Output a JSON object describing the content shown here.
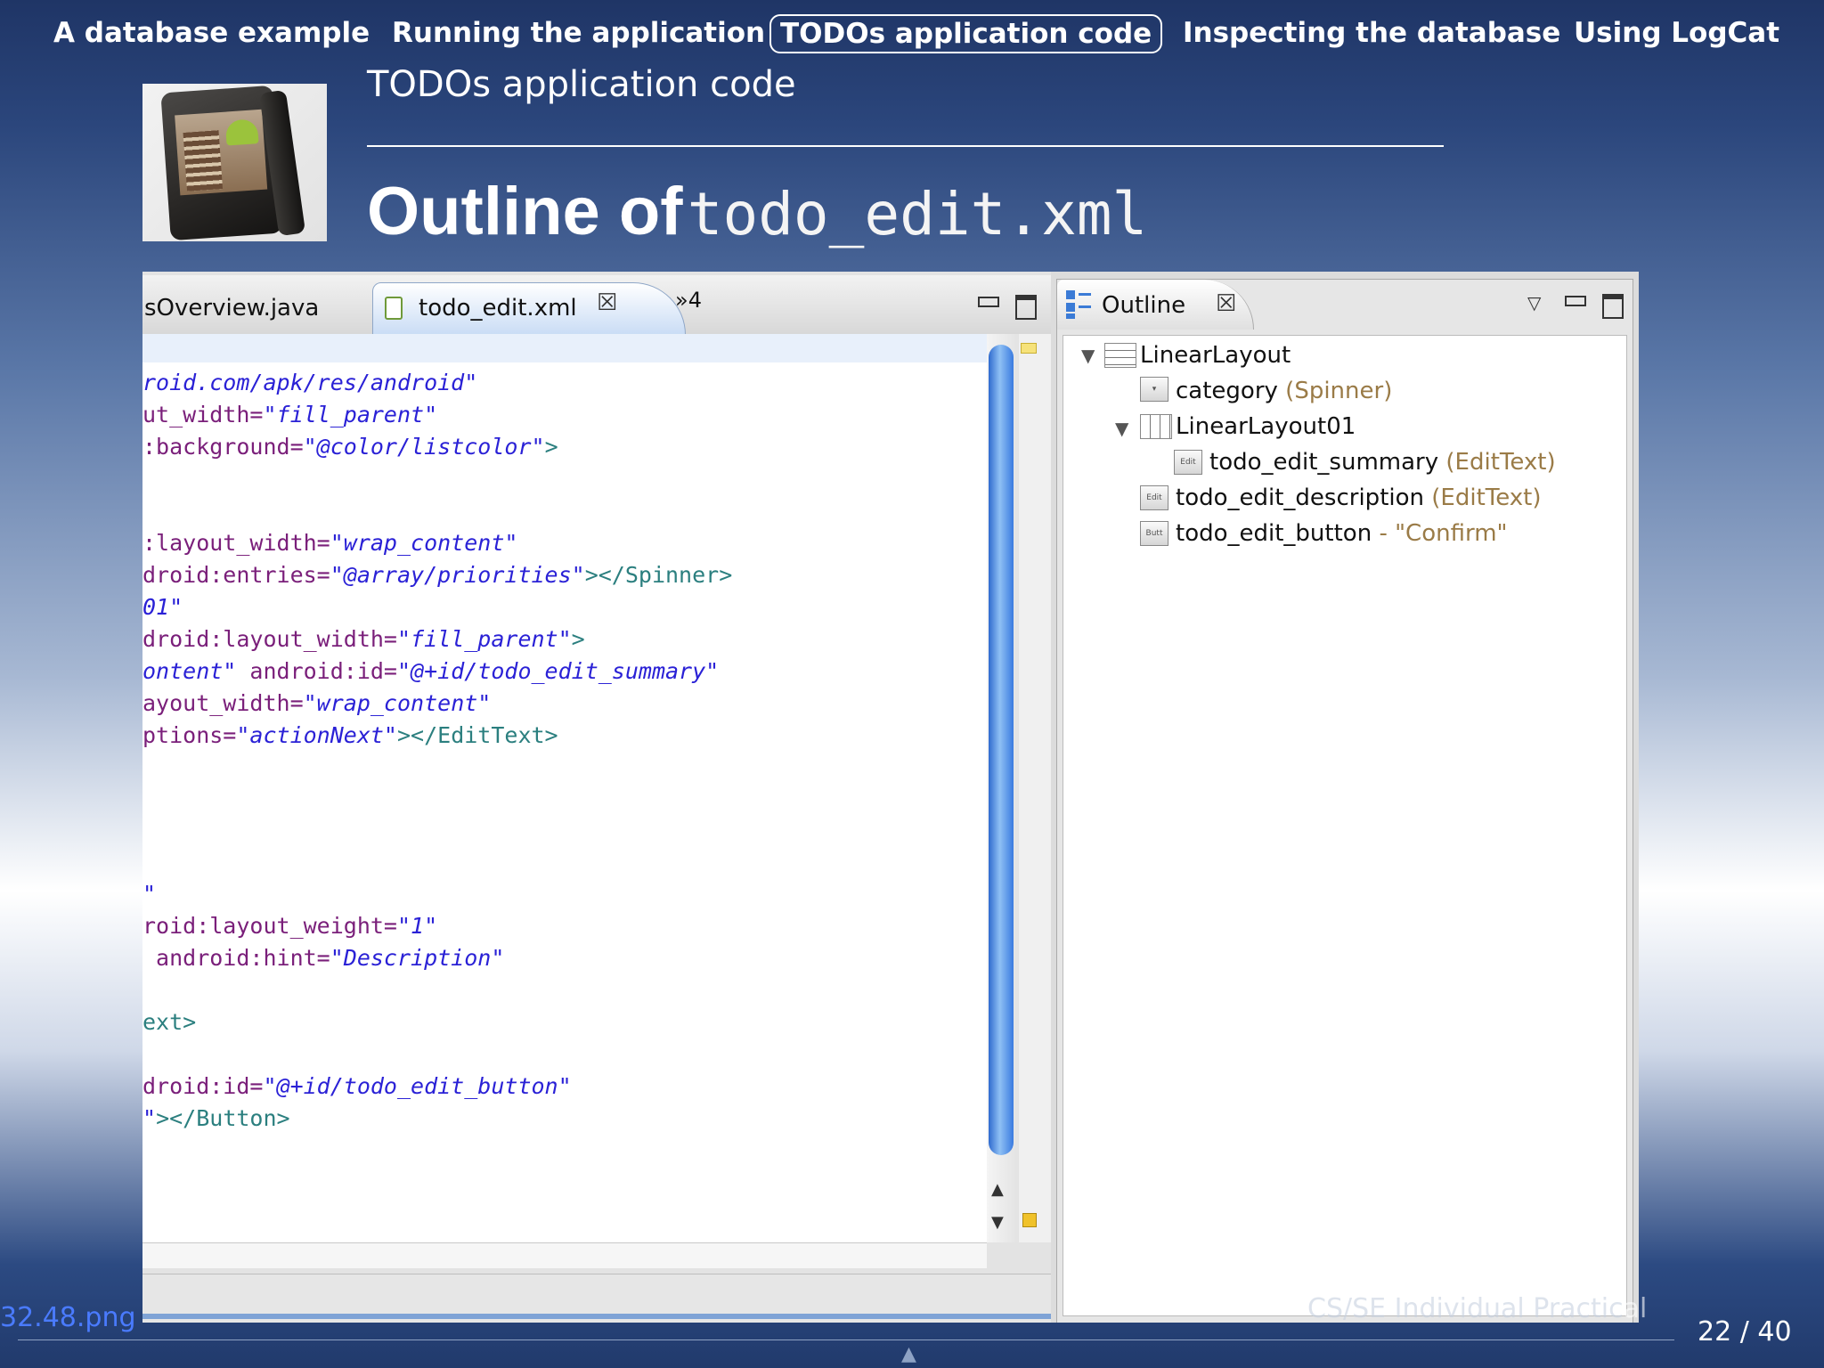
{
  "nav": {
    "items": [
      {
        "label": "A database example"
      },
      {
        "label": "Running the application"
      },
      {
        "label": "TODOs application code"
      },
      {
        "label": "Inspecting the database"
      },
      {
        "label": "Using LogCat"
      }
    ],
    "active_index": 2
  },
  "header": {
    "section_title": "TODOs application code",
    "frame_title_word": "Outline of",
    "frame_title_code": "todo_edit.xml"
  },
  "editor": {
    "tabs": {
      "partial_tab": "sOverview.java",
      "active_tab": "todo_edit.xml",
      "overflow_count": "4"
    },
    "code_lines": [
      {
        "parts": [
          {
            "t": "roid.com/apk/res/android\"",
            "k": "str"
          }
        ]
      },
      {
        "parts": [
          {
            "t": "ut_width=",
            "k": "attr"
          },
          {
            "t": "\"fill_parent\"",
            "k": "str"
          }
        ]
      },
      {
        "parts": [
          {
            "t": ":background=",
            "k": "attr"
          },
          {
            "t": "\"@color/listcolor\"",
            "k": "str"
          },
          {
            "t": ">",
            "k": "tag"
          }
        ]
      },
      {
        "parts": [
          {
            "t": ":layout_width=",
            "k": "attr"
          },
          {
            "t": "\"wrap_content\"",
            "k": "str"
          }
        ]
      },
      {
        "parts": [
          {
            "t": "droid:entries=",
            "k": "attr"
          },
          {
            "t": "\"@array/priorities\"",
            "k": "str"
          },
          {
            "t": "></Spinner>",
            "k": "tag"
          }
        ]
      },
      {
        "parts": [
          {
            "t": "01\"",
            "k": "str"
          }
        ]
      },
      {
        "parts": [
          {
            "t": "droid:layout_width=",
            "k": "attr"
          },
          {
            "t": "\"fill_parent\"",
            "k": "str"
          },
          {
            "t": ">",
            "k": "tag"
          }
        ]
      },
      {
        "parts": [
          {
            "t": "ontent\"",
            "k": "str"
          },
          {
            "t": " android:id=",
            "k": "attr"
          },
          {
            "t": "\"@+id/todo_edit_summary\"",
            "k": "str"
          }
        ]
      },
      {
        "parts": [
          {
            "t": "ayout_width=",
            "k": "attr"
          },
          {
            "t": "\"wrap_content\"",
            "k": "str"
          }
        ]
      },
      {
        "parts": [
          {
            "t": "ptions=",
            "k": "attr"
          },
          {
            "t": "\"actionNext\"",
            "k": "str"
          },
          {
            "t": "></EditText>",
            "k": "tag"
          }
        ]
      },
      {
        "parts": [
          {
            "t": "\"",
            "k": "str"
          }
        ]
      },
      {
        "parts": [
          {
            "t": "roid:layout_weight=",
            "k": "attr"
          },
          {
            "t": "\"1\"",
            "k": "str"
          }
        ]
      },
      {
        "parts": [
          {
            "t": " android:hint=",
            "k": "attr"
          },
          {
            "t": "\"Description\"",
            "k": "str"
          }
        ]
      },
      {
        "parts": [
          {
            "t": "ext>",
            "k": "tag"
          }
        ]
      },
      {
        "parts": [
          {
            "t": "droid:id=",
            "k": "attr"
          },
          {
            "t": "\"@+id/todo_edit_button\"",
            "k": "str"
          }
        ]
      },
      {
        "parts": [
          {
            "t": "\"",
            "k": "str"
          },
          {
            "t": "></Button>",
            "k": "tag"
          }
        ]
      }
    ]
  },
  "outline": {
    "tab_label": "Outline",
    "tree": [
      {
        "name": "LinearLayout",
        "type": "",
        "icon": "linear-layout-vertical-icon",
        "expanded": true
      },
      {
        "name": "category",
        "type": " (Spinner)",
        "icon": "spinner-icon"
      },
      {
        "name": "LinearLayout01",
        "type": "",
        "icon": "linear-layout-horizontal-icon",
        "expanded": true
      },
      {
        "name": "todo_edit_summary",
        "type": " (EditText)",
        "icon": "edittext-icon",
        "icon_text": "Edit"
      },
      {
        "name": "todo_edit_description",
        "type": " (EditText)",
        "icon": "edittext-icon",
        "icon_text": "Edit"
      },
      {
        "name": "todo_edit_button",
        "type": " - \"Confirm\"",
        "icon": "button-icon",
        "icon_text": "Butt"
      }
    ]
  },
  "footer": {
    "image_name": "32.48.png",
    "course_faded": "CS/SE Individual Practic",
    "course_tail": "al",
    "page": "22 / 40"
  },
  "colors": {
    "code_attr": "#7a1f7a",
    "code_string": "#2a21d6",
    "code_tag": "#2b7f7f",
    "outline_type": "#9a7b47",
    "footer_link": "#4a7bff"
  }
}
